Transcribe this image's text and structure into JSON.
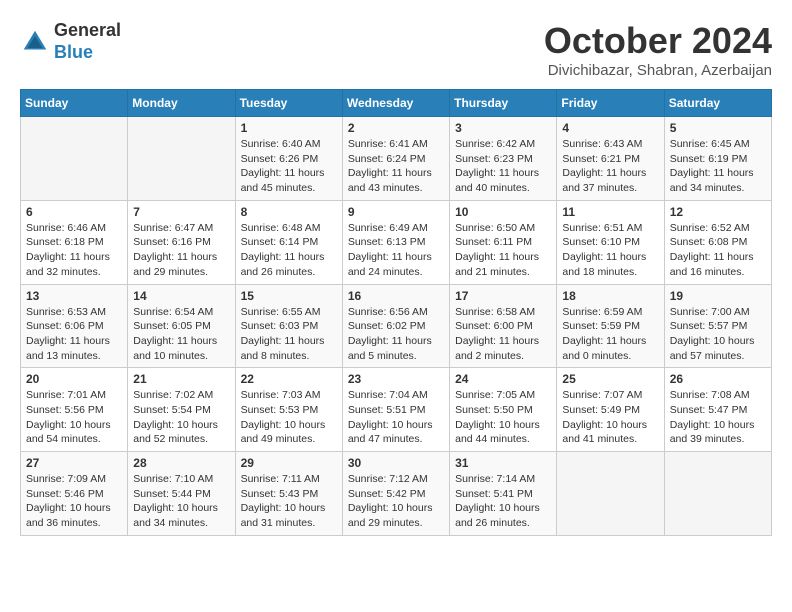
{
  "header": {
    "logo": {
      "general": "General",
      "blue": "Blue"
    },
    "title": "October 2024",
    "location": "Divichibazar, Shabran, Azerbaijan"
  },
  "calendar": {
    "days_of_week": [
      "Sunday",
      "Monday",
      "Tuesday",
      "Wednesday",
      "Thursday",
      "Friday",
      "Saturday"
    ],
    "weeks": [
      [
        {
          "day": "",
          "info": ""
        },
        {
          "day": "",
          "info": ""
        },
        {
          "day": "1",
          "info": "Sunrise: 6:40 AM\nSunset: 6:26 PM\nDaylight: 11 hours and 45 minutes."
        },
        {
          "day": "2",
          "info": "Sunrise: 6:41 AM\nSunset: 6:24 PM\nDaylight: 11 hours and 43 minutes."
        },
        {
          "day": "3",
          "info": "Sunrise: 6:42 AM\nSunset: 6:23 PM\nDaylight: 11 hours and 40 minutes."
        },
        {
          "day": "4",
          "info": "Sunrise: 6:43 AM\nSunset: 6:21 PM\nDaylight: 11 hours and 37 minutes."
        },
        {
          "day": "5",
          "info": "Sunrise: 6:45 AM\nSunset: 6:19 PM\nDaylight: 11 hours and 34 minutes."
        }
      ],
      [
        {
          "day": "6",
          "info": "Sunrise: 6:46 AM\nSunset: 6:18 PM\nDaylight: 11 hours and 32 minutes."
        },
        {
          "day": "7",
          "info": "Sunrise: 6:47 AM\nSunset: 6:16 PM\nDaylight: 11 hours and 29 minutes."
        },
        {
          "day": "8",
          "info": "Sunrise: 6:48 AM\nSunset: 6:14 PM\nDaylight: 11 hours and 26 minutes."
        },
        {
          "day": "9",
          "info": "Sunrise: 6:49 AM\nSunset: 6:13 PM\nDaylight: 11 hours and 24 minutes."
        },
        {
          "day": "10",
          "info": "Sunrise: 6:50 AM\nSunset: 6:11 PM\nDaylight: 11 hours and 21 minutes."
        },
        {
          "day": "11",
          "info": "Sunrise: 6:51 AM\nSunset: 6:10 PM\nDaylight: 11 hours and 18 minutes."
        },
        {
          "day": "12",
          "info": "Sunrise: 6:52 AM\nSunset: 6:08 PM\nDaylight: 11 hours and 16 minutes."
        }
      ],
      [
        {
          "day": "13",
          "info": "Sunrise: 6:53 AM\nSunset: 6:06 PM\nDaylight: 11 hours and 13 minutes."
        },
        {
          "day": "14",
          "info": "Sunrise: 6:54 AM\nSunset: 6:05 PM\nDaylight: 11 hours and 10 minutes."
        },
        {
          "day": "15",
          "info": "Sunrise: 6:55 AM\nSunset: 6:03 PM\nDaylight: 11 hours and 8 minutes."
        },
        {
          "day": "16",
          "info": "Sunrise: 6:56 AM\nSunset: 6:02 PM\nDaylight: 11 hours and 5 minutes."
        },
        {
          "day": "17",
          "info": "Sunrise: 6:58 AM\nSunset: 6:00 PM\nDaylight: 11 hours and 2 minutes."
        },
        {
          "day": "18",
          "info": "Sunrise: 6:59 AM\nSunset: 5:59 PM\nDaylight: 11 hours and 0 minutes."
        },
        {
          "day": "19",
          "info": "Sunrise: 7:00 AM\nSunset: 5:57 PM\nDaylight: 10 hours and 57 minutes."
        }
      ],
      [
        {
          "day": "20",
          "info": "Sunrise: 7:01 AM\nSunset: 5:56 PM\nDaylight: 10 hours and 54 minutes."
        },
        {
          "day": "21",
          "info": "Sunrise: 7:02 AM\nSunset: 5:54 PM\nDaylight: 10 hours and 52 minutes."
        },
        {
          "day": "22",
          "info": "Sunrise: 7:03 AM\nSunset: 5:53 PM\nDaylight: 10 hours and 49 minutes."
        },
        {
          "day": "23",
          "info": "Sunrise: 7:04 AM\nSunset: 5:51 PM\nDaylight: 10 hours and 47 minutes."
        },
        {
          "day": "24",
          "info": "Sunrise: 7:05 AM\nSunset: 5:50 PM\nDaylight: 10 hours and 44 minutes."
        },
        {
          "day": "25",
          "info": "Sunrise: 7:07 AM\nSunset: 5:49 PM\nDaylight: 10 hours and 41 minutes."
        },
        {
          "day": "26",
          "info": "Sunrise: 7:08 AM\nSunset: 5:47 PM\nDaylight: 10 hours and 39 minutes."
        }
      ],
      [
        {
          "day": "27",
          "info": "Sunrise: 7:09 AM\nSunset: 5:46 PM\nDaylight: 10 hours and 36 minutes."
        },
        {
          "day": "28",
          "info": "Sunrise: 7:10 AM\nSunset: 5:44 PM\nDaylight: 10 hours and 34 minutes."
        },
        {
          "day": "29",
          "info": "Sunrise: 7:11 AM\nSunset: 5:43 PM\nDaylight: 10 hours and 31 minutes."
        },
        {
          "day": "30",
          "info": "Sunrise: 7:12 AM\nSunset: 5:42 PM\nDaylight: 10 hours and 29 minutes."
        },
        {
          "day": "31",
          "info": "Sunrise: 7:14 AM\nSunset: 5:41 PM\nDaylight: 10 hours and 26 minutes."
        },
        {
          "day": "",
          "info": ""
        },
        {
          "day": "",
          "info": ""
        }
      ]
    ]
  }
}
